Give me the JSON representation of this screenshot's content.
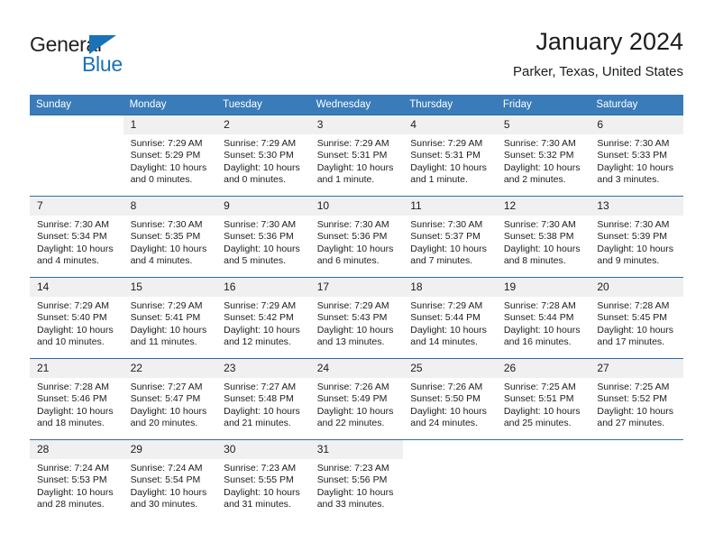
{
  "brand": {
    "word1": "General",
    "word2": "Blue",
    "accent_color": "#1a72b8"
  },
  "header": {
    "title": "January 2024",
    "subtitle": "Parker, Texas, United States"
  },
  "theme": {
    "header_bg": "#3a7cb9",
    "row_rule": "#2e6da4",
    "daynum_bg": "#f0f0f0"
  },
  "weekday_headers": [
    "Sunday",
    "Monday",
    "Tuesday",
    "Wednesday",
    "Thursday",
    "Friday",
    "Saturday"
  ],
  "weeks": [
    [
      {
        "day": "",
        "sunrise": "",
        "sunset": "",
        "daylight1": "",
        "daylight2": "",
        "blank": true
      },
      {
        "day": "1",
        "sunrise": "Sunrise: 7:29 AM",
        "sunset": "Sunset: 5:29 PM",
        "daylight1": "Daylight: 10 hours",
        "daylight2": "and 0 minutes."
      },
      {
        "day": "2",
        "sunrise": "Sunrise: 7:29 AM",
        "sunset": "Sunset: 5:30 PM",
        "daylight1": "Daylight: 10 hours",
        "daylight2": "and 0 minutes."
      },
      {
        "day": "3",
        "sunrise": "Sunrise: 7:29 AM",
        "sunset": "Sunset: 5:31 PM",
        "daylight1": "Daylight: 10 hours",
        "daylight2": "and 1 minute."
      },
      {
        "day": "4",
        "sunrise": "Sunrise: 7:29 AM",
        "sunset": "Sunset: 5:31 PM",
        "daylight1": "Daylight: 10 hours",
        "daylight2": "and 1 minute."
      },
      {
        "day": "5",
        "sunrise": "Sunrise: 7:30 AM",
        "sunset": "Sunset: 5:32 PM",
        "daylight1": "Daylight: 10 hours",
        "daylight2": "and 2 minutes."
      },
      {
        "day": "6",
        "sunrise": "Sunrise: 7:30 AM",
        "sunset": "Sunset: 5:33 PM",
        "daylight1": "Daylight: 10 hours",
        "daylight2": "and 3 minutes."
      }
    ],
    [
      {
        "day": "7",
        "sunrise": "Sunrise: 7:30 AM",
        "sunset": "Sunset: 5:34 PM",
        "daylight1": "Daylight: 10 hours",
        "daylight2": "and 4 minutes."
      },
      {
        "day": "8",
        "sunrise": "Sunrise: 7:30 AM",
        "sunset": "Sunset: 5:35 PM",
        "daylight1": "Daylight: 10 hours",
        "daylight2": "and 4 minutes."
      },
      {
        "day": "9",
        "sunrise": "Sunrise: 7:30 AM",
        "sunset": "Sunset: 5:36 PM",
        "daylight1": "Daylight: 10 hours",
        "daylight2": "and 5 minutes."
      },
      {
        "day": "10",
        "sunrise": "Sunrise: 7:30 AM",
        "sunset": "Sunset: 5:36 PM",
        "daylight1": "Daylight: 10 hours",
        "daylight2": "and 6 minutes."
      },
      {
        "day": "11",
        "sunrise": "Sunrise: 7:30 AM",
        "sunset": "Sunset: 5:37 PM",
        "daylight1": "Daylight: 10 hours",
        "daylight2": "and 7 minutes."
      },
      {
        "day": "12",
        "sunrise": "Sunrise: 7:30 AM",
        "sunset": "Sunset: 5:38 PM",
        "daylight1": "Daylight: 10 hours",
        "daylight2": "and 8 minutes."
      },
      {
        "day": "13",
        "sunrise": "Sunrise: 7:30 AM",
        "sunset": "Sunset: 5:39 PM",
        "daylight1": "Daylight: 10 hours",
        "daylight2": "and 9 minutes."
      }
    ],
    [
      {
        "day": "14",
        "sunrise": "Sunrise: 7:29 AM",
        "sunset": "Sunset: 5:40 PM",
        "daylight1": "Daylight: 10 hours",
        "daylight2": "and 10 minutes."
      },
      {
        "day": "15",
        "sunrise": "Sunrise: 7:29 AM",
        "sunset": "Sunset: 5:41 PM",
        "daylight1": "Daylight: 10 hours",
        "daylight2": "and 11 minutes."
      },
      {
        "day": "16",
        "sunrise": "Sunrise: 7:29 AM",
        "sunset": "Sunset: 5:42 PM",
        "daylight1": "Daylight: 10 hours",
        "daylight2": "and 12 minutes."
      },
      {
        "day": "17",
        "sunrise": "Sunrise: 7:29 AM",
        "sunset": "Sunset: 5:43 PM",
        "daylight1": "Daylight: 10 hours",
        "daylight2": "and 13 minutes."
      },
      {
        "day": "18",
        "sunrise": "Sunrise: 7:29 AM",
        "sunset": "Sunset: 5:44 PM",
        "daylight1": "Daylight: 10 hours",
        "daylight2": "and 14 minutes."
      },
      {
        "day": "19",
        "sunrise": "Sunrise: 7:28 AM",
        "sunset": "Sunset: 5:44 PM",
        "daylight1": "Daylight: 10 hours",
        "daylight2": "and 16 minutes."
      },
      {
        "day": "20",
        "sunrise": "Sunrise: 7:28 AM",
        "sunset": "Sunset: 5:45 PM",
        "daylight1": "Daylight: 10 hours",
        "daylight2": "and 17 minutes."
      }
    ],
    [
      {
        "day": "21",
        "sunrise": "Sunrise: 7:28 AM",
        "sunset": "Sunset: 5:46 PM",
        "daylight1": "Daylight: 10 hours",
        "daylight2": "and 18 minutes."
      },
      {
        "day": "22",
        "sunrise": "Sunrise: 7:27 AM",
        "sunset": "Sunset: 5:47 PM",
        "daylight1": "Daylight: 10 hours",
        "daylight2": "and 20 minutes."
      },
      {
        "day": "23",
        "sunrise": "Sunrise: 7:27 AM",
        "sunset": "Sunset: 5:48 PM",
        "daylight1": "Daylight: 10 hours",
        "daylight2": "and 21 minutes."
      },
      {
        "day": "24",
        "sunrise": "Sunrise: 7:26 AM",
        "sunset": "Sunset: 5:49 PM",
        "daylight1": "Daylight: 10 hours",
        "daylight2": "and 22 minutes."
      },
      {
        "day": "25",
        "sunrise": "Sunrise: 7:26 AM",
        "sunset": "Sunset: 5:50 PM",
        "daylight1": "Daylight: 10 hours",
        "daylight2": "and 24 minutes."
      },
      {
        "day": "26",
        "sunrise": "Sunrise: 7:25 AM",
        "sunset": "Sunset: 5:51 PM",
        "daylight1": "Daylight: 10 hours",
        "daylight2": "and 25 minutes."
      },
      {
        "day": "27",
        "sunrise": "Sunrise: 7:25 AM",
        "sunset": "Sunset: 5:52 PM",
        "daylight1": "Daylight: 10 hours",
        "daylight2": "and 27 minutes."
      }
    ],
    [
      {
        "day": "28",
        "sunrise": "Sunrise: 7:24 AM",
        "sunset": "Sunset: 5:53 PM",
        "daylight1": "Daylight: 10 hours",
        "daylight2": "and 28 minutes."
      },
      {
        "day": "29",
        "sunrise": "Sunrise: 7:24 AM",
        "sunset": "Sunset: 5:54 PM",
        "daylight1": "Daylight: 10 hours",
        "daylight2": "and 30 minutes."
      },
      {
        "day": "30",
        "sunrise": "Sunrise: 7:23 AM",
        "sunset": "Sunset: 5:55 PM",
        "daylight1": "Daylight: 10 hours",
        "daylight2": "and 31 minutes."
      },
      {
        "day": "31",
        "sunrise": "Sunrise: 7:23 AM",
        "sunset": "Sunset: 5:56 PM",
        "daylight1": "Daylight: 10 hours",
        "daylight2": "and 33 minutes."
      },
      {
        "day": "",
        "sunrise": "",
        "sunset": "",
        "daylight1": "",
        "daylight2": "",
        "blank": true
      },
      {
        "day": "",
        "sunrise": "",
        "sunset": "",
        "daylight1": "",
        "daylight2": "",
        "blank": true
      },
      {
        "day": "",
        "sunrise": "",
        "sunset": "",
        "daylight1": "",
        "daylight2": "",
        "blank": true
      }
    ]
  ]
}
